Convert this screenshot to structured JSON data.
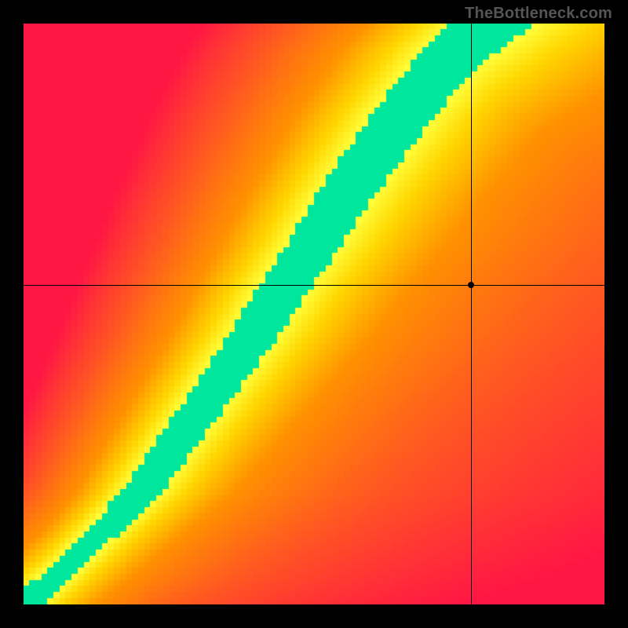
{
  "watermark": "TheBottleneck.com",
  "chart_data": {
    "type": "heatmap",
    "title": "",
    "xlabel": "",
    "ylabel": "",
    "xlim": [
      0,
      1
    ],
    "ylim": [
      0,
      1
    ],
    "grid": false,
    "legend": "none",
    "marker": {
      "x": 0.77,
      "y": 0.55
    },
    "crosshair": {
      "x": 0.77,
      "y": 0.55
    },
    "optimal_curve": {
      "description": "Optimal match ridge (green) through the heatmap, normalized 0-1 on both axes.",
      "points": [
        {
          "x": 0.0,
          "y": 0.0
        },
        {
          "x": 0.05,
          "y": 0.04
        },
        {
          "x": 0.1,
          "y": 0.09
        },
        {
          "x": 0.15,
          "y": 0.14
        },
        {
          "x": 0.2,
          "y": 0.19
        },
        {
          "x": 0.25,
          "y": 0.26
        },
        {
          "x": 0.3,
          "y": 0.33
        },
        {
          "x": 0.35,
          "y": 0.4
        },
        {
          "x": 0.4,
          "y": 0.47
        },
        {
          "x": 0.45,
          "y": 0.55
        },
        {
          "x": 0.5,
          "y": 0.62
        },
        {
          "x": 0.55,
          "y": 0.7
        },
        {
          "x": 0.6,
          "y": 0.77
        },
        {
          "x": 0.65,
          "y": 0.84
        },
        {
          "x": 0.7,
          "y": 0.9
        },
        {
          "x": 0.75,
          "y": 0.96
        },
        {
          "x": 0.8,
          "y": 1.0
        }
      ]
    },
    "color_scale": {
      "description": "Signed deviation from optimal ridge; 0 = green (ideal), ±1 toward red, pixelated.",
      "stops": [
        {
          "value": -1.0,
          "color": "#ff1744"
        },
        {
          "value": -0.6,
          "color": "#ff5722"
        },
        {
          "value": -0.3,
          "color": "#ff9100"
        },
        {
          "value": -0.15,
          "color": "#ffd600"
        },
        {
          "value": -0.06,
          "color": "#ffff3b"
        },
        {
          "value": 0.0,
          "color": "#00e69c"
        },
        {
          "value": 0.06,
          "color": "#ffff3b"
        },
        {
          "value": 0.15,
          "color": "#ffd600"
        },
        {
          "value": 0.3,
          "color": "#ff9100"
        },
        {
          "value": 0.6,
          "color": "#ff5722"
        },
        {
          "value": 1.0,
          "color": "#ff1744"
        }
      ]
    },
    "resolution_blocks": 96
  }
}
